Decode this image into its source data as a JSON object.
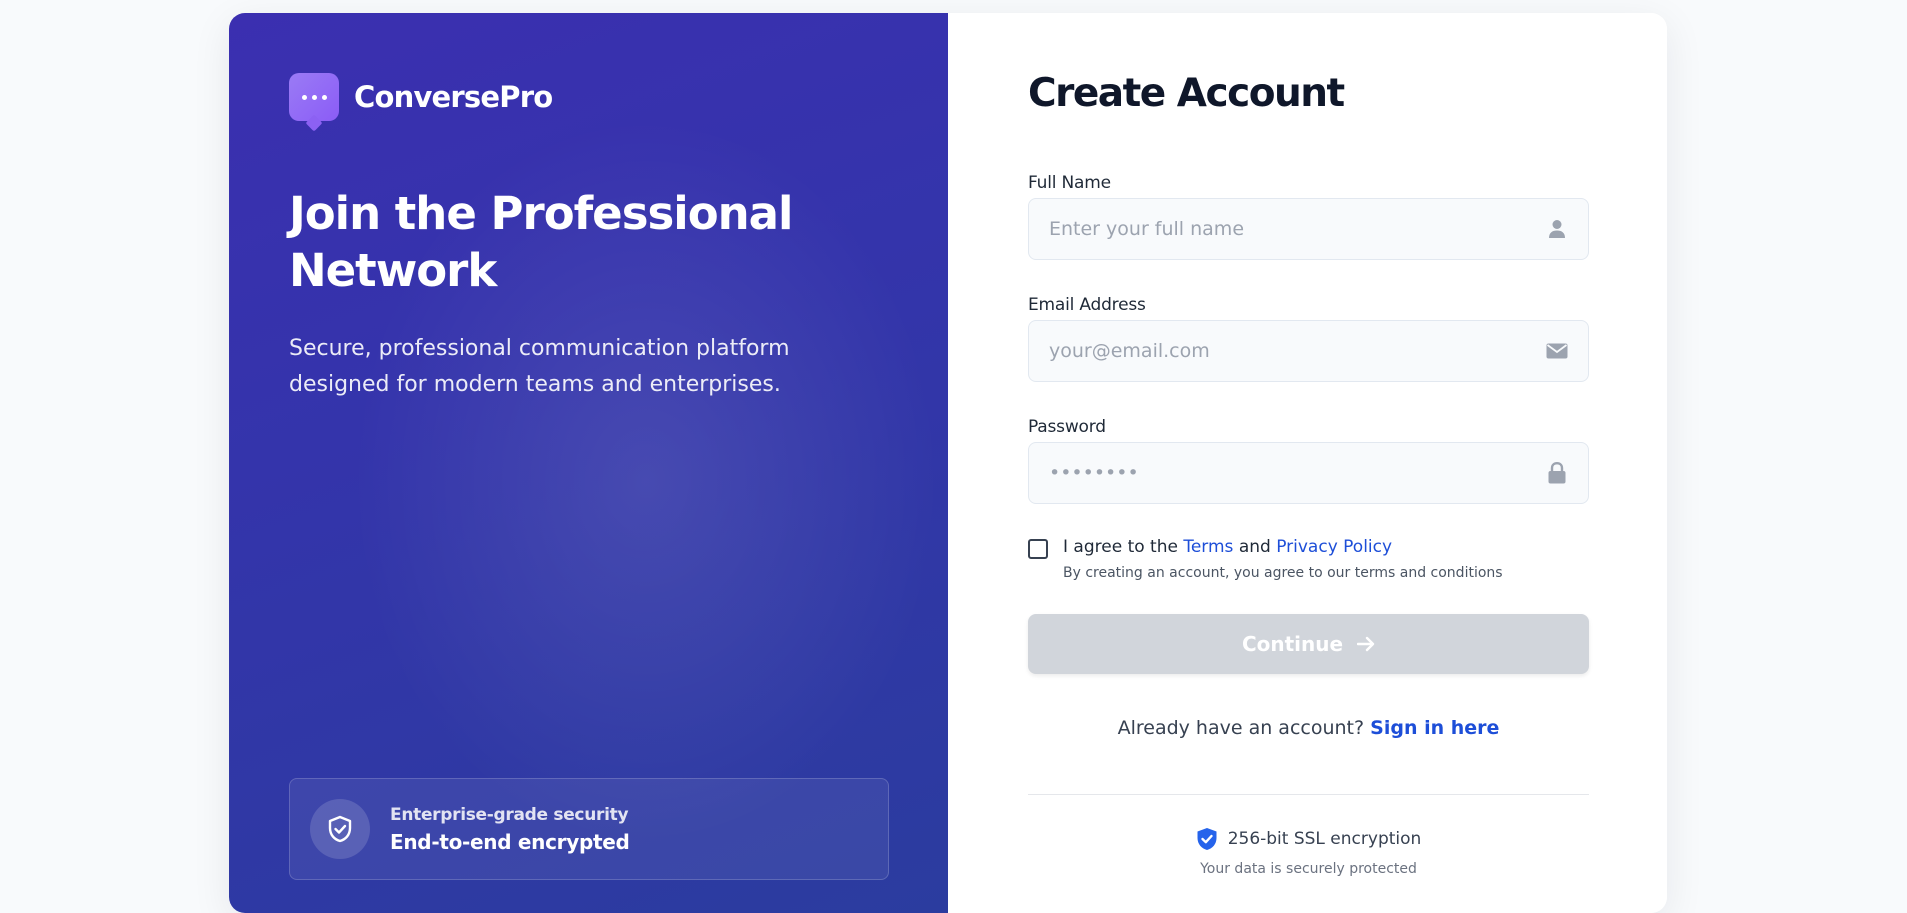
{
  "brand": {
    "name": "ConversePro",
    "icon": "chat-bubble-icon"
  },
  "hero": {
    "title": "Join the Professional Network",
    "subtitle": "Secure, professional communication platform designed for modern teams and enterprises."
  },
  "security": {
    "icon": "shield-check-icon",
    "label": "Enterprise-grade security",
    "value": "End-to-end encrypted"
  },
  "form": {
    "title": "Create Account",
    "full_name": {
      "label": "Full Name",
      "placeholder": "Enter your full name",
      "value": "",
      "icon": "user-icon"
    },
    "email": {
      "label": "Email Address",
      "placeholder": "your@email.com",
      "value": "",
      "icon": "envelope-icon"
    },
    "password": {
      "label": "Password",
      "placeholder": "••••••••",
      "value": "",
      "icon": "lock-icon"
    },
    "agree": {
      "checked": false,
      "prefix": "I agree to the",
      "terms_link": "Terms",
      "and": "and",
      "privacy_link": "Privacy Policy",
      "note": "By creating an account, you agree to our terms and conditions"
    },
    "continue_label": "Continue",
    "signin_prompt": "Already have an account?",
    "signin_link": "Sign in here",
    "ssl_text": "256-bit SSL encryption",
    "ssl_note": "Your data is securely protected"
  },
  "colors": {
    "panel_gradient_start": "#3b2fb0",
    "panel_gradient_end": "#2b3c9f",
    "link": "#1d4ed8",
    "button_disabled": "#d1d5db",
    "brand_icon": "#8b5cf6"
  }
}
